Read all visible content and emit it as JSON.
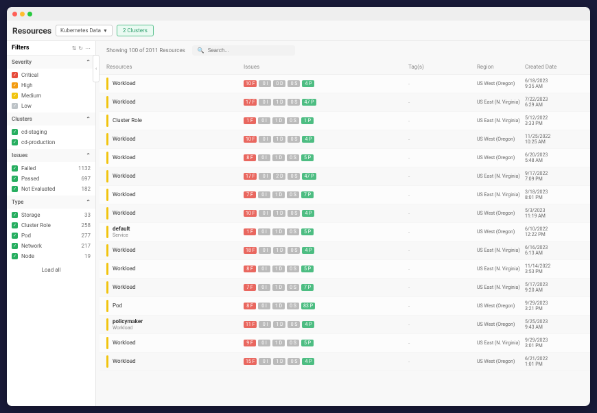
{
  "header": {
    "title": "Resources",
    "source_dropdown": "Kubernetes Data",
    "cluster_btn": "2 Clusters"
  },
  "filters": {
    "title": "Filters",
    "sections": {
      "severity": {
        "label": "Severity",
        "items": [
          {
            "label": "Critical",
            "color": "red"
          },
          {
            "label": "High",
            "color": "orange"
          },
          {
            "label": "Medium",
            "color": "yellow"
          },
          {
            "label": "Low",
            "color": "gray"
          }
        ]
      },
      "clusters": {
        "label": "Clusters",
        "items": [
          {
            "label": "cd-staging",
            "color": "green"
          },
          {
            "label": "cd-production",
            "color": "green"
          }
        ]
      },
      "issues": {
        "label": "Issues",
        "items": [
          {
            "label": "Failed",
            "color": "green",
            "count": "1132"
          },
          {
            "label": "Passed",
            "color": "green",
            "count": "697"
          },
          {
            "label": "Not Evaluated",
            "color": "green",
            "count": "182"
          }
        ]
      },
      "type": {
        "label": "Type",
        "items": [
          {
            "label": "Storage",
            "color": "green",
            "count": "33"
          },
          {
            "label": "Cluster Role",
            "color": "green",
            "count": "258"
          },
          {
            "label": "Pod",
            "color": "green",
            "count": "277"
          },
          {
            "label": "Network",
            "color": "green",
            "count": "217"
          },
          {
            "label": "Node",
            "color": "green",
            "count": "19"
          }
        ]
      }
    },
    "load_all": "Load all"
  },
  "main": {
    "showing": "Showing 100 of 2011 Resources",
    "search_placeholder": "Search...",
    "columns": {
      "resources": "Resources",
      "issues": "Issues",
      "tags": "Tag(s)",
      "region": "Region",
      "created": "Created Date"
    },
    "rows": [
      {
        "name": "Workload",
        "sub": "",
        "f": "10",
        "i": "0",
        "d": "0",
        "s": "0",
        "p": "4",
        "region": "US West (Oregon)",
        "date": "6/18/2023",
        "time": "9:35 AM"
      },
      {
        "name": "Workload",
        "sub": "",
        "f": "17",
        "i": "0",
        "d": "1",
        "s": "0",
        "p": "47",
        "region": "US East (N. Virginia)",
        "date": "7/22/2023",
        "time": "6:29 AM"
      },
      {
        "name": "Cluster Role",
        "sub": "",
        "f": "1",
        "i": "0",
        "d": "1",
        "s": "0",
        "p": "1",
        "region": "US East (N. Virginia)",
        "date": "5/12/2022",
        "time": "3:33 PM"
      },
      {
        "name": "Workload",
        "sub": "",
        "f": "10",
        "i": "0",
        "d": "1",
        "s": "0",
        "p": "4",
        "region": "US West (Oregon)",
        "date": "11/25/2022",
        "time": "10:25 AM"
      },
      {
        "name": "Workload",
        "sub": "",
        "f": "8",
        "i": "0",
        "d": "1",
        "s": "0",
        "p": "5",
        "region": "US West (Oregon)",
        "date": "6/20/2023",
        "time": "5:48 AM"
      },
      {
        "name": "Workload",
        "sub": "",
        "f": "17",
        "i": "0",
        "d": "2",
        "s": "0",
        "p": "47",
        "region": "US East (N. Virginia)",
        "date": "9/17/2022",
        "time": "7:09 PM"
      },
      {
        "name": "Workload",
        "sub": "",
        "f": "7",
        "i": "0",
        "d": "1",
        "s": "0",
        "p": "7",
        "region": "US East (N. Virginia)",
        "date": "3/18/2023",
        "time": "8:01 PM"
      },
      {
        "name": "Workload",
        "sub": "",
        "f": "10",
        "i": "0",
        "d": "1",
        "s": "0",
        "p": "4",
        "region": "US West (Oregon)",
        "date": "5/3/2023",
        "time": "11:19 AM"
      },
      {
        "name": "default",
        "sub": "Service",
        "bold": true,
        "f": "1",
        "i": "0",
        "d": "1",
        "s": "0",
        "p": "5",
        "region": "US West (Oregon)",
        "date": "6/10/2022",
        "time": "12:22 PM"
      },
      {
        "name": "Workload",
        "sub": "",
        "f": "18",
        "i": "0",
        "d": "1",
        "s": "0",
        "p": "4",
        "region": "US East (N. Virginia)",
        "date": "6/16/2023",
        "time": "6:13 AM"
      },
      {
        "name": "Workload",
        "sub": "",
        "f": "8",
        "i": "0",
        "d": "1",
        "s": "0",
        "p": "5",
        "region": "US East (N. Virginia)",
        "date": "11/14/2022",
        "time": "3:53 PM"
      },
      {
        "name": "Workload",
        "sub": "",
        "f": "7",
        "i": "0",
        "d": "1",
        "s": "0",
        "p": "7",
        "region": "US East (N. Virginia)",
        "date": "5/17/2023",
        "time": "9:20 AM"
      },
      {
        "name": "Pod",
        "sub": "",
        "f": "8",
        "i": "0",
        "d": "1",
        "s": "0",
        "p": "83",
        "region": "US West (Oregon)",
        "date": "9/29/2023",
        "time": "3:21 PM"
      },
      {
        "name": "policymaker",
        "sub": "Workload",
        "bold": true,
        "f": "11",
        "i": "0",
        "d": "1",
        "s": "0",
        "p": "4",
        "region": "US West (Oregon)",
        "date": "5/25/2023",
        "time": "9:43 AM"
      },
      {
        "name": "Workload",
        "sub": "",
        "f": "9",
        "i": "0",
        "d": "1",
        "s": "0",
        "p": "5",
        "region": "US East (N. Virginia)",
        "date": "9/29/2023",
        "time": "3:01 PM"
      },
      {
        "name": "Workload",
        "sub": "",
        "f": "15",
        "i": "0",
        "d": "1",
        "s": "0",
        "p": "4",
        "region": "US West (Oregon)",
        "date": "6/21/2022",
        "time": "1:01 PM"
      }
    ]
  }
}
